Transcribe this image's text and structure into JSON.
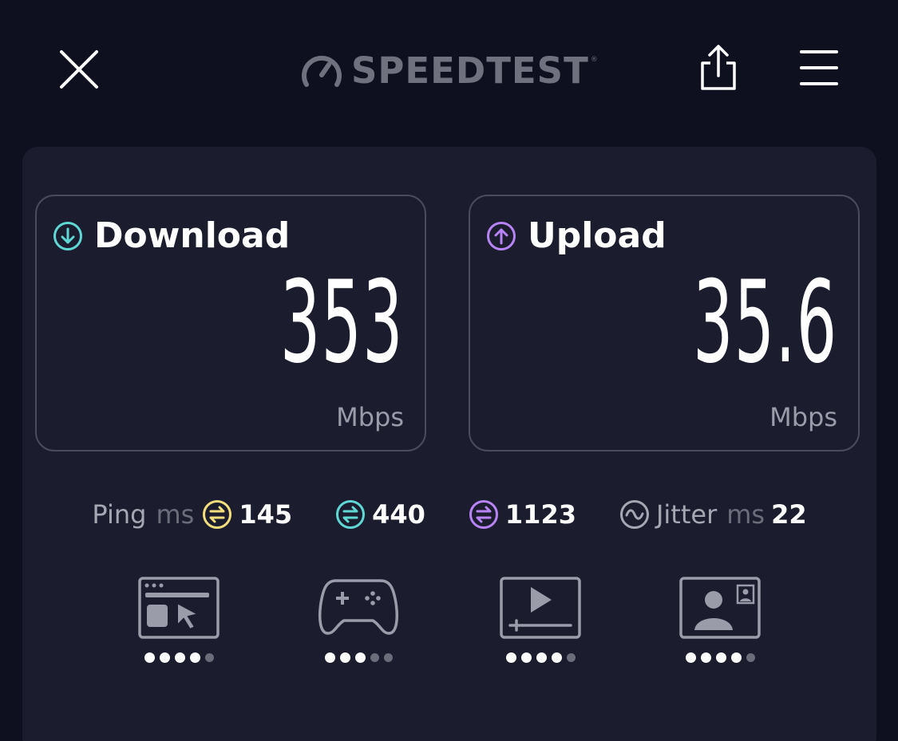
{
  "header": {
    "logo_text": "SPEEDTEST",
    "logo_trademark": "®",
    "close_icon": "close-icon",
    "share_icon": "share-icon",
    "menu_icon": "hamburger-menu-icon"
  },
  "download": {
    "title": "Download",
    "value": "353",
    "unit": "Mbps",
    "icon": "download-arrow-icon",
    "accent": "#5fd8d4"
  },
  "upload": {
    "title": "Upload",
    "value": "35.6",
    "unit": "Mbps",
    "icon": "upload-arrow-icon",
    "accent": "#b883f4"
  },
  "ping": {
    "label": "Ping",
    "unit": "ms",
    "idle": {
      "value": "145",
      "color": "#f4de7c"
    },
    "download": {
      "value": "440",
      "color": "#5fd8d4"
    },
    "upload": {
      "value": "1123",
      "color": "#b883f4"
    }
  },
  "jitter": {
    "label": "Jitter",
    "unit": "ms",
    "value": "22",
    "color": "#a5a7b3"
  },
  "quality": [
    {
      "name": "web-browsing",
      "icon": "web-browsing-icon",
      "rating": 4,
      "max": 5
    },
    {
      "name": "gaming",
      "icon": "gamepad-icon",
      "rating": 3,
      "max": 5
    },
    {
      "name": "video-streaming",
      "icon": "video-player-icon",
      "rating": 4,
      "max": 5
    },
    {
      "name": "video-chat",
      "icon": "video-chat-icon",
      "rating": 4,
      "max": 5
    }
  ]
}
